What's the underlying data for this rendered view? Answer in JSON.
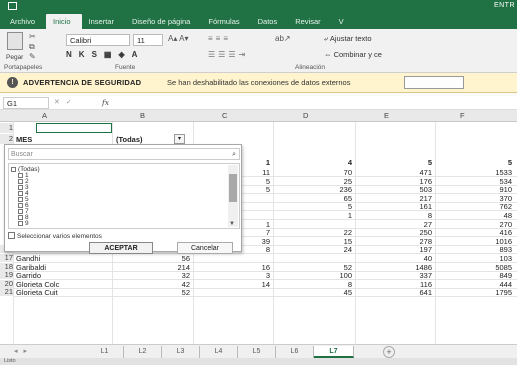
{
  "titlebar": {
    "filename": "ENTR"
  },
  "tabs": [
    "Archivo",
    "Inicio",
    "Insertar",
    "Diseño de página",
    "Fórmulas",
    "Datos",
    "Revisar",
    "V"
  ],
  "ribbon": {
    "paste_label": "Pegar",
    "font_name": "Calibri",
    "font_size": "11",
    "bold": "N",
    "italic": "K",
    "underline": "S",
    "wrap_text": "Ajustar texto",
    "merge_center": "Combinar y ce",
    "groups": {
      "clipboard": "Portapapeles",
      "font": "Fuente",
      "alignment": "Alineación"
    }
  },
  "security_bar": {
    "title": "ADVERTENCIA DE SEGURIDAD",
    "message": "Se han deshabilitado las conexiones de datos externos"
  },
  "formula_bar": {
    "name_box": "G1",
    "fx": "fx"
  },
  "grid": {
    "columns": [
      "A",
      "B",
      "C",
      "D",
      "E",
      "F"
    ],
    "row1": "1",
    "row2": {
      "num": "2",
      "a": "MES",
      "b": "(Todas)"
    },
    "numeric_header": [
      "1",
      "4",
      "5",
      "5"
    ],
    "rows": [
      {
        "b": "",
        "c": "11",
        "d": "70",
        "e": "471",
        "f": "1533"
      },
      {
        "b": "",
        "c": "5",
        "d": "25",
        "e": "176",
        "f": "534"
      },
      {
        "b": "",
        "c": "5",
        "d": "236",
        "e": "503",
        "f": "910"
      },
      {
        "b": "",
        "c": "",
        "d": "65",
        "e": "217",
        "f": "370"
      },
      {
        "b": "",
        "c": "",
        "d": "5",
        "e": "161",
        "f": "762"
      },
      {
        "b": "",
        "c": "",
        "d": "1",
        "e": "8",
        "f": "48"
      },
      {
        "b": "",
        "c": "1",
        "d": "",
        "e": "27",
        "f": "270"
      },
      {
        "b": "",
        "c": "7",
        "d": "22",
        "e": "250",
        "f": "416"
      },
      {
        "b": "",
        "c": "39",
        "d": "15",
        "e": "278",
        "f": "1016"
      },
      {
        "num": "16",
        "a": "Excelsior",
        "b": "32",
        "c": "8",
        "d": "24",
        "e": "197",
        "f": "893"
      },
      {
        "num": "17",
        "a": "Gandhi",
        "b": "56",
        "c": "",
        "d": "",
        "e": "40",
        "f": "103"
      },
      {
        "num": "18",
        "a": "Garibaldi",
        "b": "214",
        "c": "16",
        "d": "52",
        "e": "1486",
        "f": "5085"
      },
      {
        "num": "19",
        "a": "Garrido",
        "b": "32",
        "c": "3",
        "d": "100",
        "e": "337",
        "f": "849"
      },
      {
        "num": "20",
        "a": "Glorieta Colc",
        "b": "42",
        "c": "14",
        "d": "8",
        "e": "116",
        "f": "444"
      },
      {
        "num": "21",
        "a": "Glorieta Cuit",
        "b": "52",
        "c": "",
        "d": "45",
        "e": "641",
        "f": "1795"
      }
    ]
  },
  "filter_popup": {
    "search_placeholder": "Buscar",
    "items": [
      "(Todas)",
      "1",
      "2",
      "3",
      "4",
      "5",
      "6",
      "7",
      "8",
      "9"
    ],
    "multi_select": "Seleccionar varios elementos",
    "ok": "ACEPTAR",
    "cancel": "Cancelar"
  },
  "sheets": [
    "L1",
    "L2",
    "L3",
    "L4",
    "L5",
    "L6",
    "L7"
  ],
  "active_sheet": "L7",
  "status": "Listo"
}
